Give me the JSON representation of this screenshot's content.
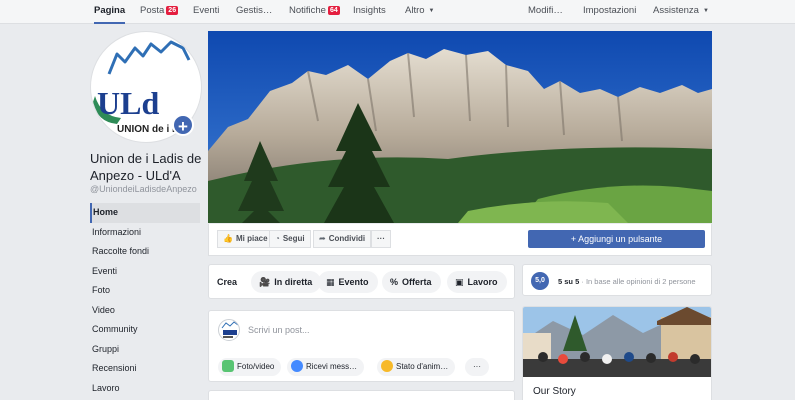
{
  "nav": {
    "pagina": "Pagina",
    "posta": "Posta",
    "posta_badge": "26",
    "eventi": "Eventi",
    "gestisci": "Gestis…",
    "notifiche": "Notifiche",
    "notifiche_badge": "64",
    "insights": "Insights",
    "altro": "Altro",
    "modifica": "Modifi…",
    "impostazioni": "Impostazioni",
    "assistenza": "Assistenza"
  },
  "profile": {
    "name": "Union de i Ladis de Anpezo - ULd'A",
    "handle": "@UniondeiLadisdeAnpezo",
    "logo_text": "ULd",
    "logo_subtitle": "UNION de i LA"
  },
  "sidebar": {
    "items": [
      {
        "label": "Home"
      },
      {
        "label": "Informazioni"
      },
      {
        "label": "Raccolte fondi"
      },
      {
        "label": "Eventi"
      },
      {
        "label": "Foto"
      },
      {
        "label": "Video"
      },
      {
        "label": "Community"
      },
      {
        "label": "Gruppi"
      },
      {
        "label": "Recensioni"
      },
      {
        "label": "Lavoro"
      }
    ]
  },
  "actions": {
    "mi_piace": "Mi piace",
    "segui": "Segui",
    "condividi": "Condividi",
    "more": "···",
    "add_button": "Aggiungi un pulsante"
  },
  "crea": {
    "label": "Crea",
    "in_diretta": "In diretta",
    "evento": "Evento",
    "offerta": "Offerta",
    "lavoro": "Lavoro"
  },
  "composer": {
    "placeholder": "Scrivi un post...",
    "foto_video": "Foto/video",
    "ricevi_messaggi": "Ricevi mess…",
    "stato": "Stato d'anim…",
    "more": "···"
  },
  "rating": {
    "score": "5,0",
    "summary": "5 su 5",
    "detail": "· In base alle opinioni di 2 persone"
  },
  "story": {
    "title": "Our Story"
  },
  "colors": {
    "fb_blue": "#4267b2",
    "badge_red": "#e41e3f",
    "background": "#e9ebee"
  }
}
